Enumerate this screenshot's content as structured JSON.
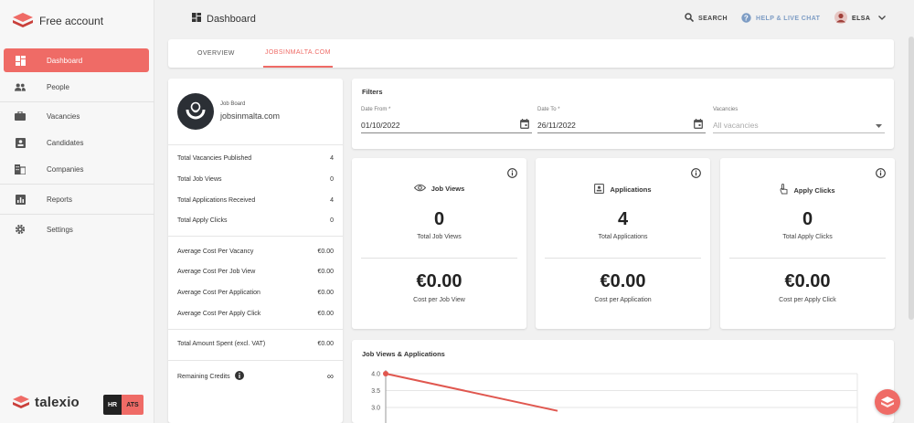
{
  "sidebar": {
    "brand": "Free account",
    "items": [
      {
        "label": "Dashboard"
      },
      {
        "label": "People"
      },
      {
        "label": "Vacancies"
      },
      {
        "label": "Candidates"
      },
      {
        "label": "Companies"
      },
      {
        "label": "Reports"
      },
      {
        "label": "Settings"
      }
    ],
    "footer_brand": "talexio",
    "badge_hr": "HR",
    "badge_ats": "ATS"
  },
  "header": {
    "title": "Dashboard",
    "search": "SEARCH",
    "help": "HELP & LIVE CHAT",
    "user": "ELSA"
  },
  "tabs": [
    {
      "label": "OVERVIEW"
    },
    {
      "label": "JOBSINMALTA.COM"
    }
  ],
  "summary": {
    "caption": "Job Board",
    "board_name": "jobsinmalta.com",
    "rows": [
      {
        "label": "Total Vacancies Published",
        "value": "4"
      },
      {
        "label": "Total Job Views",
        "value": "0"
      },
      {
        "label": "Total Applications Received",
        "value": "4"
      },
      {
        "label": "Total Apply Clicks",
        "value": "0"
      },
      {
        "label": "Average Cost Per Vacancy",
        "value": "€0.00"
      },
      {
        "label": "Average Cost Per Job View",
        "value": "€0.00"
      },
      {
        "label": "Average Cost Per Application",
        "value": "€0.00"
      },
      {
        "label": "Average Cost Per Apply Click",
        "value": "€0.00"
      },
      {
        "label": "Total Amount Spent (excl. VAT)",
        "value": "€0.00"
      },
      {
        "label": "Remaining Credits",
        "value": "∞"
      }
    ]
  },
  "filters": {
    "title": "Filters",
    "date_from_label": "Date From *",
    "date_from": "01/10/2022",
    "date_to_label": "Date To *",
    "date_to": "26/11/2022",
    "vacancies_label": "Vacancies",
    "vacancies_placeholder": "All vacancies"
  },
  "stats": [
    {
      "title": "Job Views",
      "value": "0",
      "value_label": "Total Job Views",
      "cost": "€0.00",
      "cost_label": "Cost per Job View"
    },
    {
      "title": "Applications",
      "value": "4",
      "value_label": "Total Applications",
      "cost": "€0.00",
      "cost_label": "Cost per Application"
    },
    {
      "title": "Apply Clicks",
      "value": "0",
      "value_label": "Total Apply Clicks",
      "cost": "€0.00",
      "cost_label": "Cost per Apply Click"
    }
  ],
  "colors": {
    "accent": "#ef6b66",
    "sidebar_bg": "#f7f7f7",
    "page_bg": "#f1f1f1"
  },
  "chart_data": {
    "type": "line",
    "title": "Job Views & Applications",
    "xlabel": "",
    "ylabel": "",
    "y_ticks": [
      "4.0",
      "3.5",
      "3.0"
    ],
    "ylim_visible": [
      2.9,
      4.0
    ],
    "series": [
      {
        "color": "#e0574f",
        "x": [
          0,
          1
        ],
        "y": [
          4.0,
          2.9
        ]
      }
    ],
    "grid": true
  }
}
